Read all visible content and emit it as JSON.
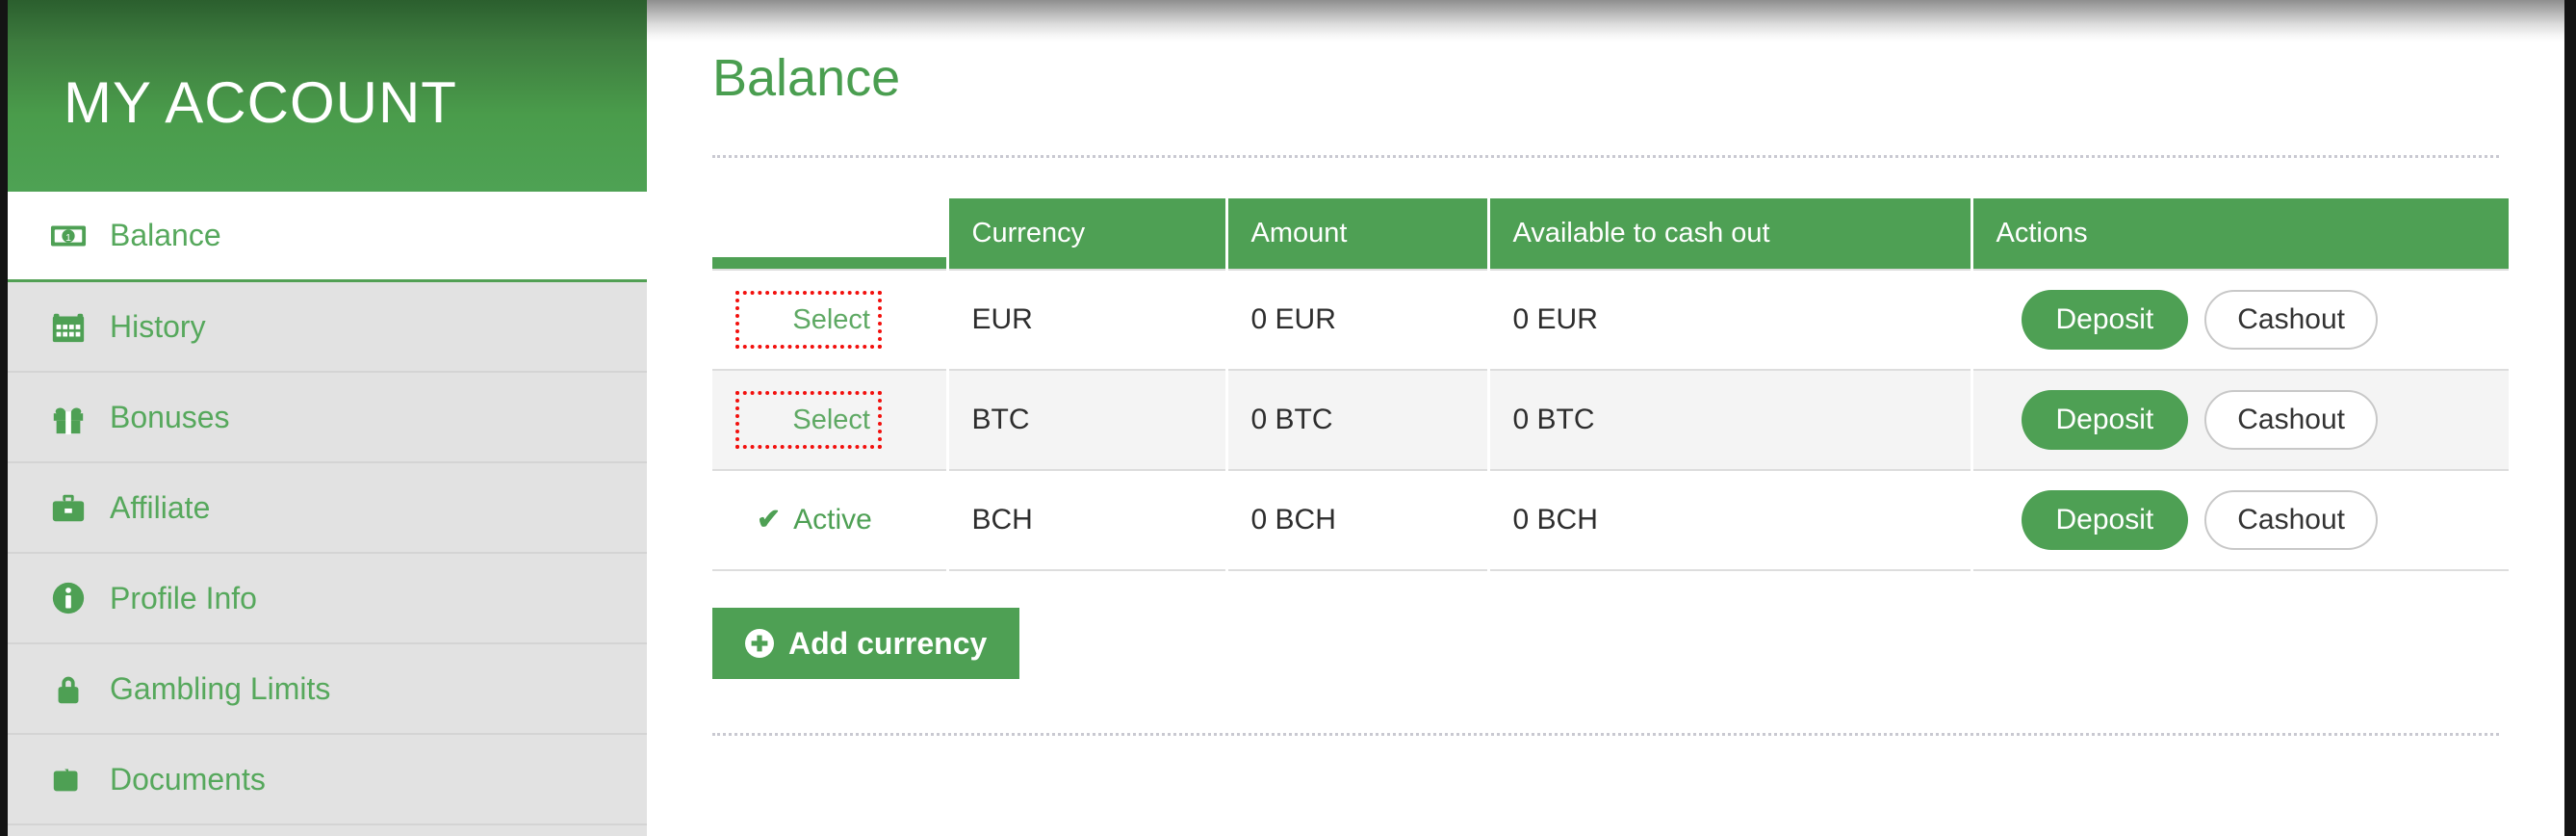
{
  "sidebar": {
    "title": "MY ACCOUNT",
    "items": [
      {
        "label": "Balance",
        "icon": "money-bill-icon",
        "active": true
      },
      {
        "label": "History",
        "icon": "calendar-icon",
        "active": false
      },
      {
        "label": "Bonuses",
        "icon": "gift-icon",
        "active": false
      },
      {
        "label": "Affiliate",
        "icon": "briefcase-icon",
        "active": false
      },
      {
        "label": "Profile Info",
        "icon": "info-circle-icon",
        "active": false
      },
      {
        "label": "Gambling Limits",
        "icon": "lock-icon",
        "active": false
      },
      {
        "label": "Documents",
        "icon": "folder-icon",
        "active": false
      }
    ]
  },
  "main": {
    "page_title": "Balance",
    "table": {
      "headers": [
        "",
        "Currency",
        "Amount",
        "Available to cash out",
        "Actions"
      ],
      "rows": [
        {
          "status_label": "Select",
          "status_type": "select",
          "currency": "EUR",
          "amount": "0 EUR",
          "available": "0 EUR",
          "deposit_label": "Deposit",
          "cashout_label": "Cashout"
        },
        {
          "status_label": "Select",
          "status_type": "select",
          "currency": "BTC",
          "amount": "0 BTC",
          "available": "0 BTC",
          "deposit_label": "Deposit",
          "cashout_label": "Cashout"
        },
        {
          "status_label": "Active",
          "status_type": "active",
          "currency": "BCH",
          "amount": "0 BCH",
          "available": "0 BCH",
          "deposit_label": "Deposit",
          "cashout_label": "Cashout"
        }
      ]
    },
    "add_currency_label": "Add currency"
  },
  "colors": {
    "brand_green": "#4ea054",
    "header_green_dark": "#2b5f2e",
    "link_green": "#56a85c",
    "focus_red": "#f2100d",
    "row_stripe": "#f4f4f4",
    "sidebar_bg": "#e2e2e2"
  },
  "icons": {
    "check": "✔",
    "plus_circle": "plus-circle-icon"
  }
}
